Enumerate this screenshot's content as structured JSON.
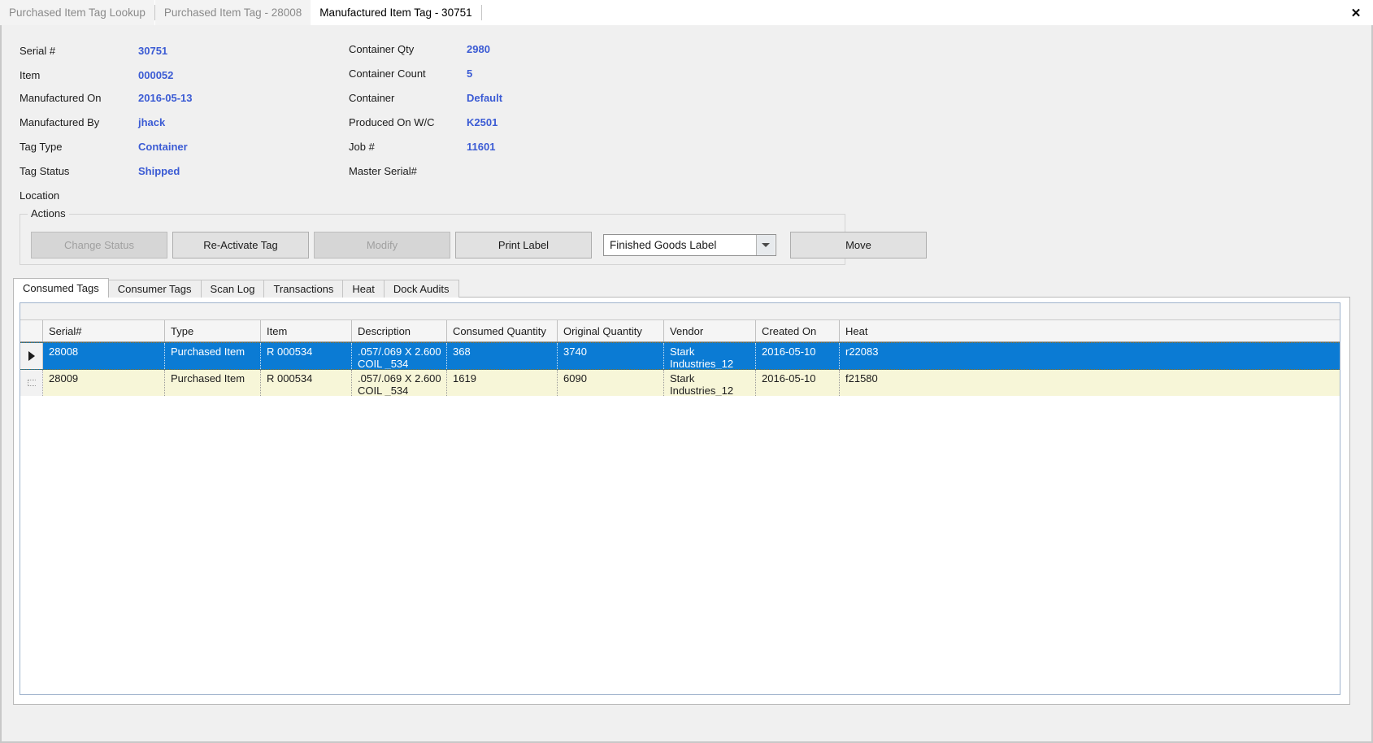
{
  "window": {
    "close_icon": "close-icon",
    "close_glyph": "✕"
  },
  "document_tabs": [
    {
      "label": "Purchased Item Tag Lookup",
      "active": false
    },
    {
      "label": "Purchased Item Tag - 28008",
      "active": false
    },
    {
      "label": "Manufactured Item Tag - 30751",
      "active": true
    }
  ],
  "details": {
    "left_fields": [
      {
        "label": "Serial #",
        "value": "30751"
      },
      {
        "label": "Item",
        "value": "000052"
      },
      {
        "label": "Manufactured On",
        "value": "2016-05-13"
      },
      {
        "label": "Manufactured By",
        "value": "jhack"
      },
      {
        "label": "Tag Type",
        "value": "Container"
      },
      {
        "label": "Tag Status",
        "value": "Shipped"
      },
      {
        "label": "Location",
        "value": ""
      }
    ],
    "right_fields": [
      {
        "label": "Container Qty",
        "value": "2980"
      },
      {
        "label": "Container Count",
        "value": "5"
      },
      {
        "label": "Container",
        "value": "Default"
      },
      {
        "label": "Produced On W/C",
        "value": "K2501"
      },
      {
        "label": "Job #",
        "value": "11601"
      },
      {
        "label": "Master Serial#",
        "value": ""
      }
    ]
  },
  "actions": {
    "legend": "Actions",
    "buttons": [
      {
        "label": "Change Status",
        "enabled": false
      },
      {
        "label": "Re-Activate Tag",
        "enabled": true
      },
      {
        "label": "Modify",
        "enabled": false
      },
      {
        "label": "Print Label",
        "enabled": true
      },
      {
        "label": "Move",
        "enabled": true
      }
    ],
    "label_type_select": {
      "value": "Finished Goods Label",
      "chevron_icon": "chevron-down-icon"
    }
  },
  "inner_tabs": [
    {
      "label": "Consumed Tags",
      "active": true
    },
    {
      "label": "Consumer Tags",
      "active": false
    },
    {
      "label": "Scan Log",
      "active": false
    },
    {
      "label": "Transactions",
      "active": false
    },
    {
      "label": "Heat",
      "active": false
    },
    {
      "label": "Dock Audits",
      "active": false
    }
  ],
  "grid": {
    "columns": [
      "Serial#",
      "Type",
      "Item",
      "Description",
      "Consumed Quantity",
      "Original Quantity",
      "Vendor",
      "Created On",
      "Heat"
    ],
    "rows": [
      {
        "selected": true,
        "indicator": "▶",
        "cells": [
          "28008",
          "Purchased Item",
          "R 000534",
          ".057/.069 X 2.600\nCOIL   _534",
          "368",
          "3740",
          "Stark\nIndustries_12",
          "2016-05-10",
          "r22083"
        ]
      },
      {
        "selected": false,
        "indicator": "",
        "cells": [
          "28009",
          "Purchased Item",
          "R 000534",
          ".057/.069 X 2.600\nCOIL   _534",
          "1619",
          "6090",
          "Stark\nIndustries_12",
          "2016-05-10",
          "f21580"
        ]
      }
    ]
  },
  "colors": {
    "value_blue": "#3b5bd4",
    "selection_blue": "#0b7bd4",
    "alt_row_yellow": "#f7f6d8",
    "panel_gray": "#f0f0f0"
  }
}
